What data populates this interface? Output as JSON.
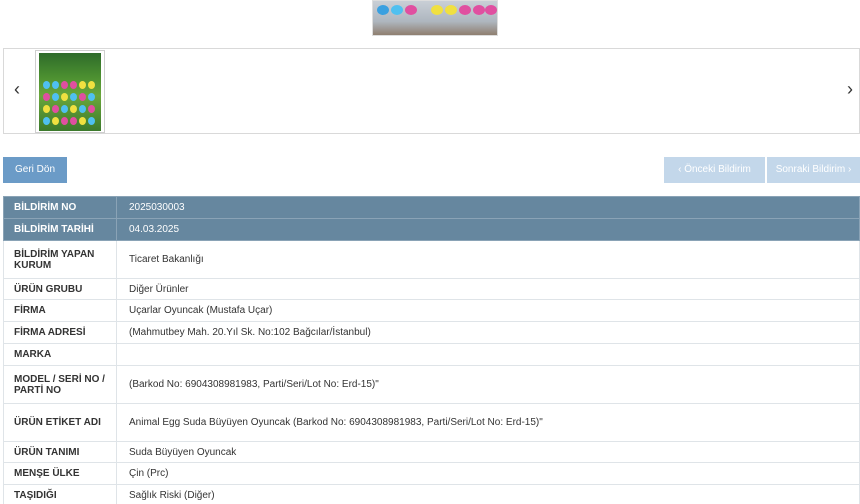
{
  "nav": {
    "prev_arrow": "‹",
    "next_arrow": "›"
  },
  "buttons": {
    "back": "Geri Dön",
    "previous": "‹ Önceki Bildirim",
    "next": "Sonraki Bildirim ›"
  },
  "rows": [
    {
      "label": "BİLDİRİM NO",
      "value": "2025030003"
    },
    {
      "label": "BİLDİRİM TARİHİ",
      "value": "04.03.2025"
    },
    {
      "label": "BİLDİRİM YAPAN KURUM",
      "value": "Ticaret Bakanlığı"
    },
    {
      "label": "ÜRÜN GRUBU",
      "value": "Diğer Ürünler"
    },
    {
      "label": "FİRMA",
      "value": "Uçarlar Oyuncak (Mustafa Uçar)"
    },
    {
      "label": "FİRMA ADRESİ",
      "value": "(Mahmutbey Mah. 20.Yıl Sk. No:102 Bağcılar/İstanbul)"
    },
    {
      "label": "MARKA",
      "value": ""
    },
    {
      "label": "MODEL / SERİ NO / PARTİ NO",
      "value": "(Barkod No: 6904308981983, Parti/Seri/Lot No: Erd-15)\""
    },
    {
      "label": "ÜRÜN ETİKET ADI",
      "value": "Animal Egg Suda Büyüyen Oyuncak (Barkod No: 6904308981983, Parti/Seri/Lot No: Erd-15)\""
    },
    {
      "label": "ÜRÜN TANIMI",
      "value": "Suda Büyüyen Oyuncak"
    },
    {
      "label": "MENŞE ÜLKE",
      "value": "Çin (Prc)"
    },
    {
      "label": "TAŞIDIĞI",
      "value": "Sağlık Riski (Diğer)"
    }
  ],
  "colors": {
    "header_row": "#66879f",
    "back_button": "#6b9bc7",
    "nav_buttons_disabled": "#c3d7ea"
  }
}
